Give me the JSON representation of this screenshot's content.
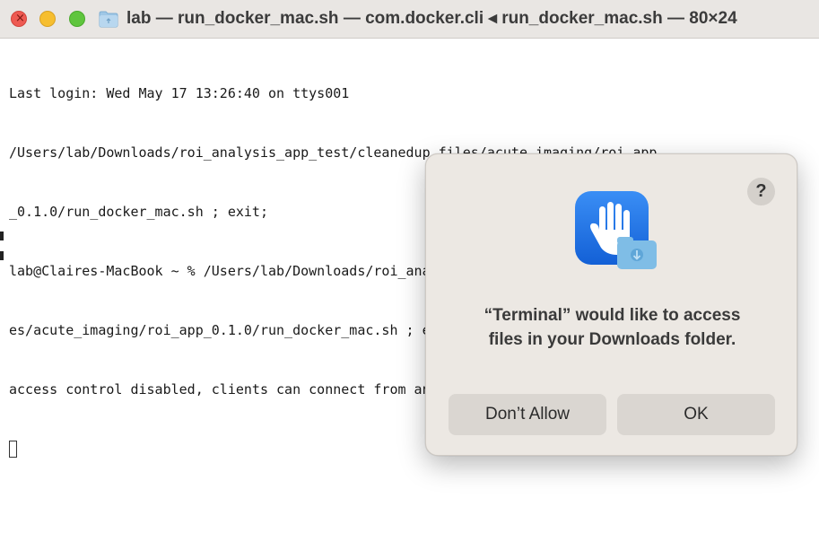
{
  "window": {
    "title": "lab — run_docker_mac.sh — com.docker.cli ◂ run_docker_mac.sh — 80×24",
    "traffic_lights": {
      "close": "×"
    }
  },
  "terminal": {
    "lines": [
      "Last login: Wed May 17 13:26:40 on ttys001",
      "/Users/lab/Downloads/roi_analysis_app_test/cleanedup_files/acute_imaging/roi_app",
      "_0.1.0/run_docker_mac.sh ; exit;",
      "lab@Claires-MacBook ~ % /Users/lab/Downloads/roi_analysis_app_test/cleanedup_fil",
      "es/acute_imaging/roi_app_0.1.0/run_docker_mac.sh ; exit;",
      "access control disabled, clients can connect from any host"
    ]
  },
  "dialog": {
    "help_label": "?",
    "message_line1": "“Terminal” would like to access",
    "message_line2": "files in your Downloads folder.",
    "deny_label": "Don’t Allow",
    "ok_label": "OK",
    "icon": "privacy-hand-icon",
    "accent": "#1c6fe6"
  }
}
